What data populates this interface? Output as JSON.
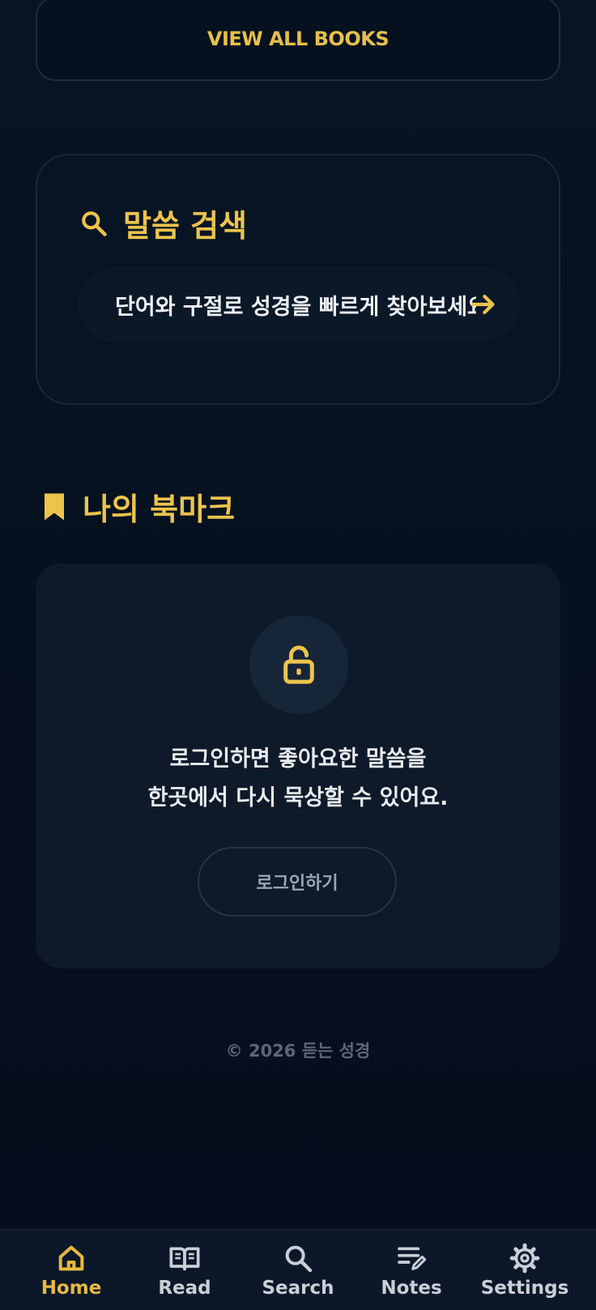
{
  "view_all": {
    "label": "VIEW ALL BOOKS"
  },
  "search_card": {
    "title": "말씀 검색",
    "pill_text": "단어와 구절로 성경을 빠르게 찾아보세요",
    "icon": "search-icon"
  },
  "bookmarks": {
    "title": "나의 북마크",
    "message_line1": "로그인하면 좋아요한 말씀을",
    "message_line2": "한곳에서 다시 묵상할 수 있어요.",
    "login_label": "로그인하기",
    "icon": "lock-icon"
  },
  "footer": {
    "copyright": "© 2026 듣는 성경"
  },
  "nav": {
    "items": [
      {
        "label": "Home",
        "icon": "home-icon",
        "active": true
      },
      {
        "label": "Read",
        "icon": "book-open-icon",
        "active": false
      },
      {
        "label": "Search",
        "icon": "search-icon",
        "active": false
      },
      {
        "label": "Notes",
        "icon": "notes-icon",
        "active": false
      },
      {
        "label": "Settings",
        "icon": "gear-icon",
        "active": false
      }
    ]
  },
  "colors": {
    "accent": "#e6b93f",
    "background": "#06101f",
    "card": "#0e1929"
  }
}
